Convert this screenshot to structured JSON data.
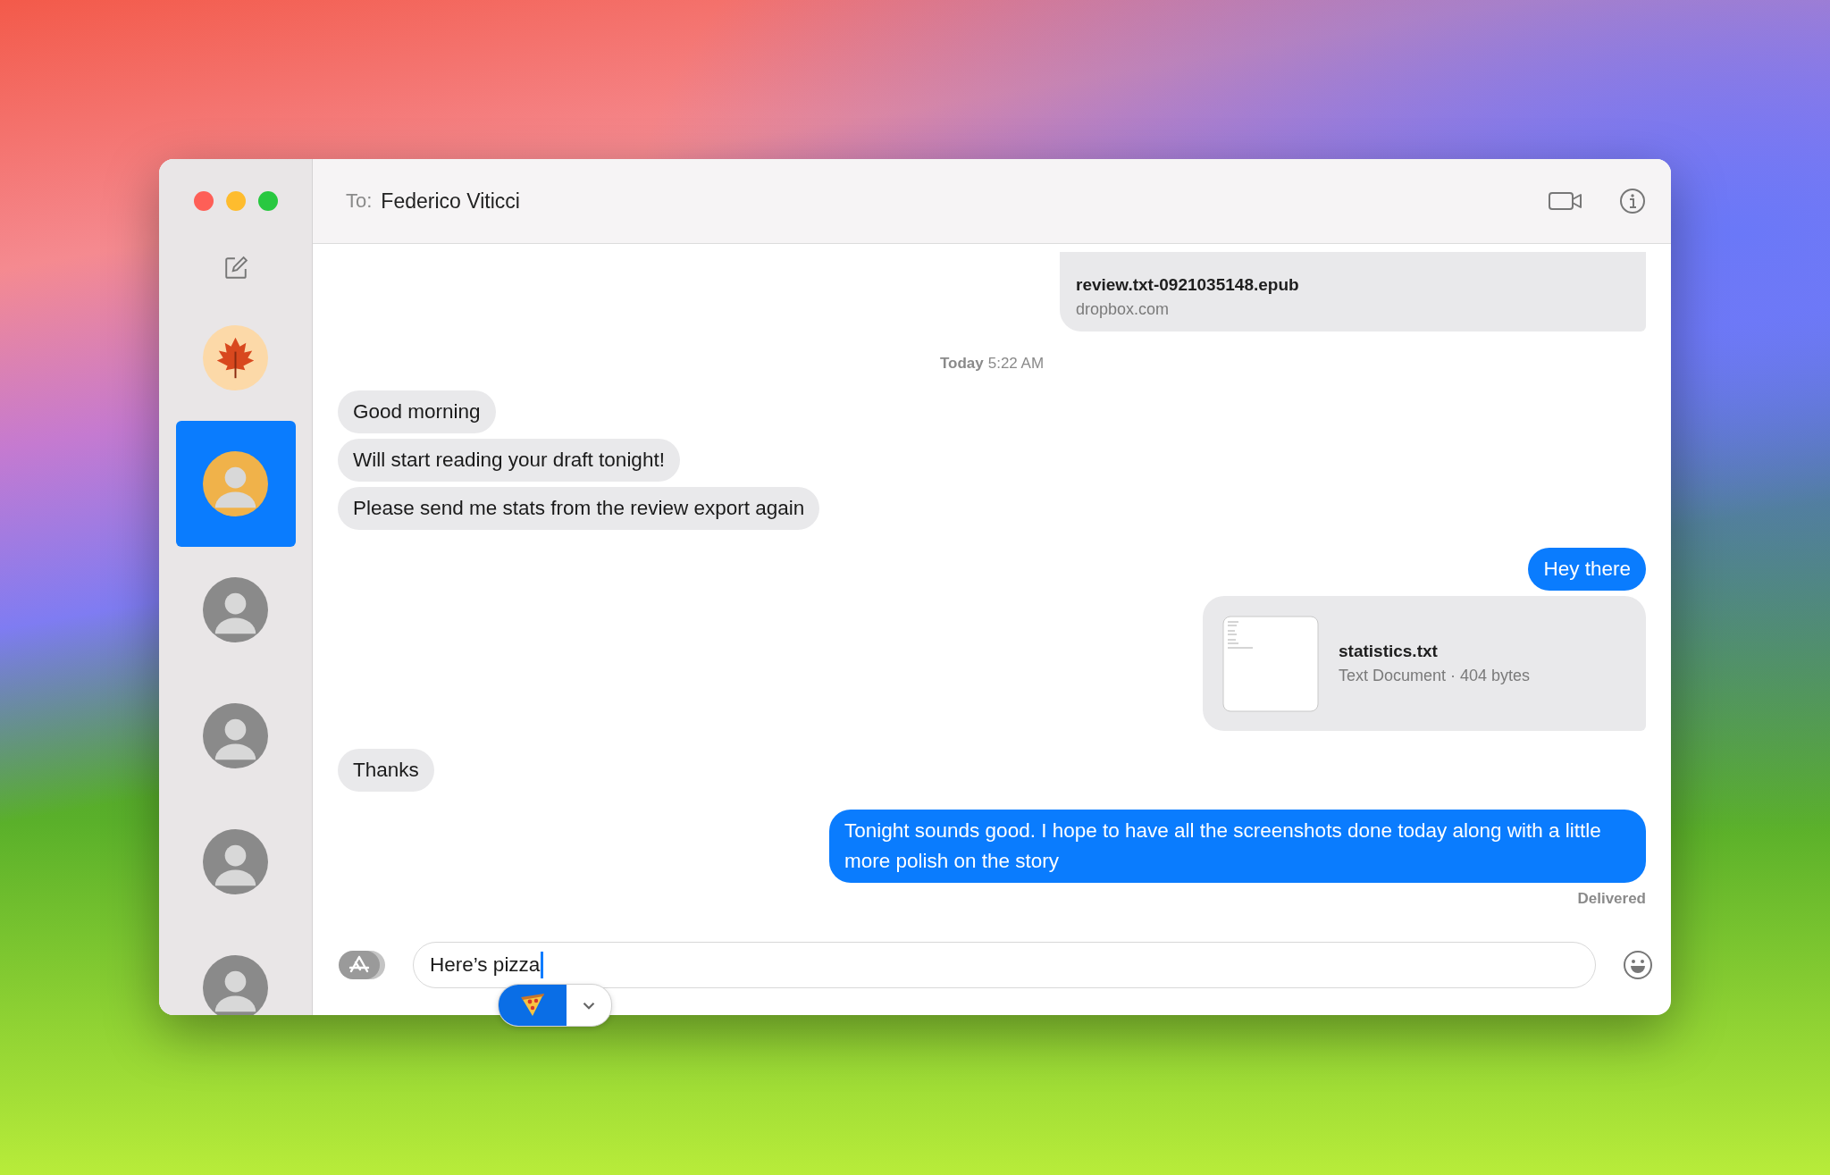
{
  "conversations": [
    {
      "kind": "leaf",
      "selected": false
    },
    {
      "kind": "photo",
      "selected": true
    },
    {
      "kind": "photo",
      "selected": false
    },
    {
      "kind": "photo",
      "selected": false
    },
    {
      "kind": "photo",
      "selected": false
    },
    {
      "kind": "photo",
      "selected": false
    }
  ],
  "header": {
    "to_label": "To:",
    "recipient": "Federico Viticci"
  },
  "messages": [
    {
      "kind": "link",
      "outgoing": true,
      "title": "review.txt-0921035148.epub",
      "subtitle": "dropbox.com"
    },
    {
      "kind": "timestamp",
      "day": "Today",
      "time": "5:22 AM"
    },
    {
      "kind": "text",
      "outgoing": false,
      "text": "Good morning"
    },
    {
      "kind": "text",
      "outgoing": false,
      "text": "Will start reading your draft tonight!"
    },
    {
      "kind": "text",
      "outgoing": false,
      "text": "Please send me stats from the review export again"
    },
    {
      "kind": "text",
      "outgoing": true,
      "text": "Hey there"
    },
    {
      "kind": "file",
      "outgoing": true,
      "title": "statistics.txt",
      "subtitle": "Text Document · 404 bytes"
    },
    {
      "kind": "text",
      "outgoing": false,
      "text": "Thanks"
    },
    {
      "kind": "text",
      "outgoing": true,
      "text": "Tonight sounds good. I hope to have all the screenshots done today along with a little more polish on the story"
    },
    {
      "kind": "status",
      "text": "Delivered"
    }
  ],
  "composer": {
    "value": "Here’s pizza"
  }
}
